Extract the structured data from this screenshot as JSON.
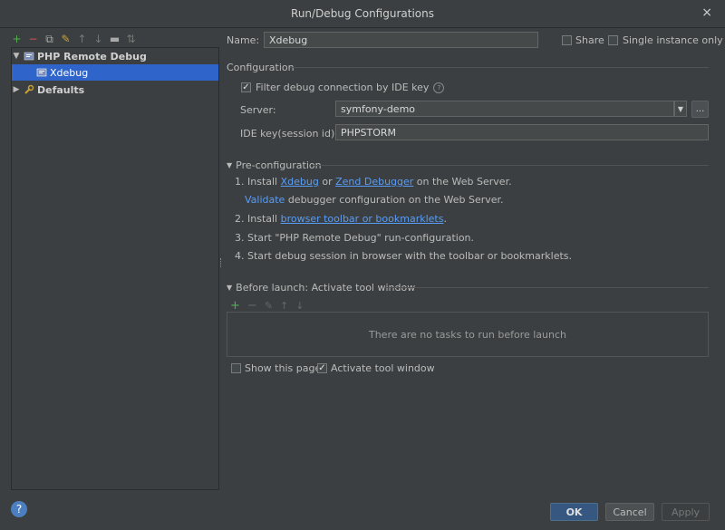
{
  "window": {
    "title": "Run/Debug Configurations",
    "close_glyph": "×"
  },
  "left_toolbar": [
    {
      "name": "add-icon",
      "glyph": "+",
      "color": "#4fb24f"
    },
    {
      "name": "remove-icon",
      "glyph": "−",
      "color": "#d05050"
    },
    {
      "name": "copy-icon",
      "glyph": "⧉",
      "color": "#aaaaaa"
    },
    {
      "name": "edit-defaults-icon",
      "glyph": "✎",
      "color": "#c9a235"
    },
    {
      "name": "move-up-icon",
      "glyph": "↑",
      "color": "#777777"
    },
    {
      "name": "move-down-icon",
      "glyph": "↓",
      "color": "#777777"
    },
    {
      "name": "folder-icon",
      "glyph": "▬",
      "color": "#aaaaaa"
    },
    {
      "name": "sort-icon",
      "glyph": "⇅",
      "color": "#777777"
    }
  ],
  "tree": {
    "group_label": "PHP Remote Debug",
    "item_label": "Xdebug",
    "defaults_label": "Defaults"
  },
  "form": {
    "name_label": "Name:",
    "name_value": "Xdebug",
    "share_label": "Share",
    "single_instance_label": "Single instance only",
    "configuration_heading": "Configuration",
    "filter_label": "Filter debug connection by IDE key",
    "filter_checked": true,
    "server_label": "Server:",
    "server_value": "symfony-demo",
    "server_more": "...",
    "ide_key_label": "IDE key(session id):",
    "ide_key_value": "PHPSTORM"
  },
  "preconfig": {
    "heading": "Pre-configuration",
    "step1_prefix": "1. Install ",
    "step1_link1": "Xdebug",
    "step1_or": " or ",
    "step1_link2": "Zend Debugger",
    "step1_suffix": " on the Web Server.",
    "validate_link": "Validate",
    "validate_suffix": " debugger configuration on the Web Server.",
    "step2_prefix": "2. Install ",
    "step2_link": "browser toolbar or bookmarklets",
    "step2_suffix": ".",
    "step3": "3. Start \"PHP Remote Debug\" run-configuration.",
    "step4": "4. Start debug session in browser with the toolbar or bookmarklets."
  },
  "before_launch": {
    "heading": "Before launch: Activate tool window",
    "empty_text": "There are no tasks to run before launch",
    "show_page_label": "Show this page",
    "show_page_checked": false,
    "activate_label": "Activate tool window",
    "activate_checked": true
  },
  "buttons": {
    "ok": "OK",
    "cancel": "Cancel",
    "apply": "Apply",
    "help": "?"
  }
}
